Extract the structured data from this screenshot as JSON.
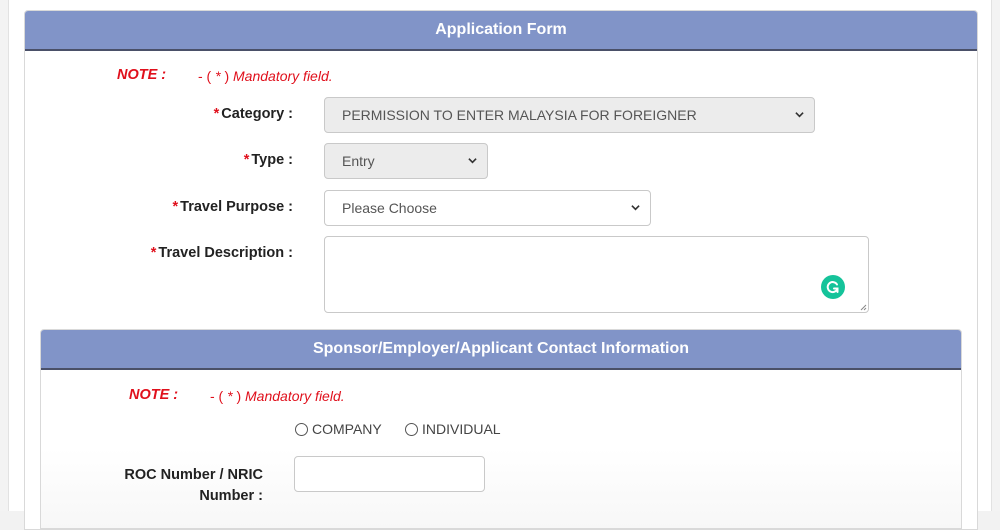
{
  "form": {
    "title": "Application Form",
    "note": {
      "label": "NOTE :",
      "dash": "- ( ",
      "asterisk": "*",
      "close": " ) ",
      "text": "Mandatory field."
    },
    "required_mark": "*",
    "fields": {
      "category": {
        "label": "Category :",
        "value": "PERMISSION TO ENTER MALAYSIA FOR FOREIGNER",
        "disabled": true
      },
      "type": {
        "label": "Type :",
        "value": "Entry",
        "disabled": true
      },
      "travel_purpose": {
        "label": "Travel Purpose :",
        "value": "Please Choose",
        "disabled": false
      },
      "travel_description": {
        "label": "Travel Description :",
        "value": ""
      }
    },
    "grammarly_icon": "grammarly-icon"
  },
  "contact": {
    "title": "Sponsor/Employer/Applicant Contact Information",
    "note": {
      "label": "NOTE :",
      "dash": "- ( ",
      "asterisk": "*",
      "close": " ) ",
      "text": "Mandatory field."
    },
    "applicant_type_options": [
      {
        "label": "COMPANY",
        "selected": false
      },
      {
        "label": "INDIVIDUAL",
        "selected": false
      }
    ],
    "roc_field": {
      "label_line1": "ROC Number / NRIC",
      "label_line2": "Number :",
      "value": ""
    }
  },
  "colors": {
    "header_bg": "#8194c8",
    "mandatory_red": "#e0101c",
    "grammarly_green": "#15c39a"
  }
}
